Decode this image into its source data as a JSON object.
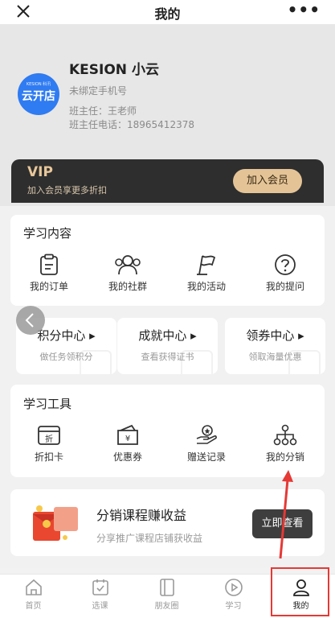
{
  "topbar": {
    "title": "我的",
    "more": "•••"
  },
  "user": {
    "avatar_brand": "KESION 科汛",
    "avatar_text": "云开店",
    "name": "KESION 小云",
    "phone": "未绑定手机号",
    "teacher": "班主任：王老师",
    "teacher_phone": "班主任电话：18965412378"
  },
  "vip": {
    "title": "VIP",
    "subtitle": "加入会员享更多折扣",
    "button": "加入会员"
  },
  "study": {
    "title": "学习内容",
    "items": [
      {
        "label": "我的订单",
        "icon": "clipboard-icon"
      },
      {
        "label": "我的社群",
        "icon": "group-icon"
      },
      {
        "label": "我的活动",
        "icon": "flag-icon"
      },
      {
        "label": "我的提问",
        "icon": "question-icon"
      }
    ]
  },
  "centers": [
    {
      "title": "积分中心 ▸",
      "subtitle": "做任务领积分"
    },
    {
      "title": "成就中心 ▸",
      "subtitle": "查看获得证书"
    },
    {
      "title": "领券中心 ▸",
      "subtitle": "领取海量优惠"
    }
  ],
  "tools": {
    "title": "学习工具",
    "items": [
      {
        "label": "折扣卡",
        "icon": "discount-card-icon",
        "glyph": "折"
      },
      {
        "label": "优惠券",
        "icon": "coupon-icon",
        "glyph": "¥"
      },
      {
        "label": "赠送记录",
        "icon": "gift-record-icon"
      },
      {
        "label": "我的分销",
        "icon": "distribution-icon"
      }
    ]
  },
  "promo": {
    "title": "分销课程赚收益",
    "subtitle": "分享推广课程店铺获收益",
    "button": "立即查看"
  },
  "tabs": [
    {
      "label": "首页",
      "icon": "home-icon"
    },
    {
      "label": "选课",
      "icon": "course-icon"
    },
    {
      "label": "朋友圈",
      "icon": "moments-icon"
    },
    {
      "label": "学习",
      "icon": "play-icon"
    },
    {
      "label": "我的",
      "icon": "user-icon",
      "active": true
    }
  ],
  "colors": {
    "accent": "#e53935",
    "vip_gold": "#e4c497",
    "avatar_blue": "#2f7bf2"
  }
}
